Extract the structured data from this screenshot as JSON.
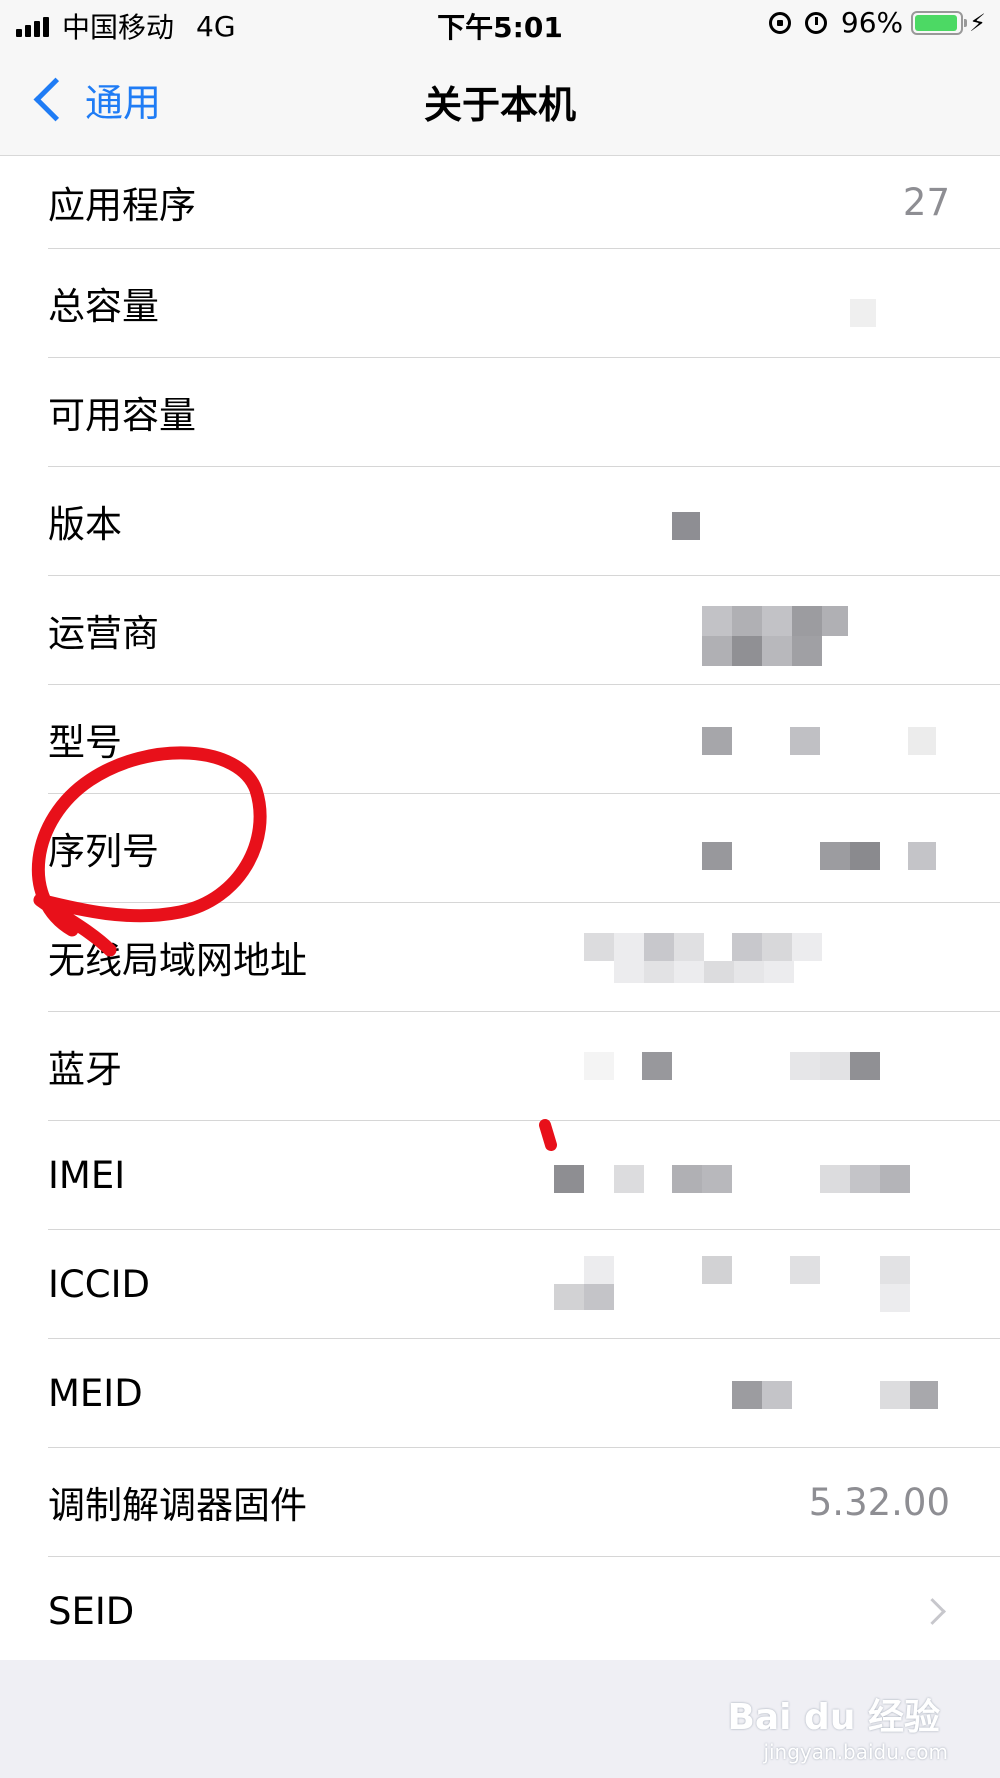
{
  "status_bar": {
    "carrier": "中国移动",
    "network": "4G",
    "time": "下午5:01",
    "battery_percent": "96%",
    "battery_level": 0.96,
    "battery_color": "#4cd964"
  },
  "nav": {
    "back_label": "通用",
    "title": "关于本机",
    "accent_color": "#1f7cf5"
  },
  "rows": [
    {
      "label": "应用程序",
      "value": "27"
    },
    {
      "label": "总容量",
      "value": ""
    },
    {
      "label": "可用容量",
      "value": ""
    },
    {
      "label": "版本",
      "value": ""
    },
    {
      "label": "运营商",
      "value": ""
    },
    {
      "label": "型号",
      "value": ""
    },
    {
      "label": "序列号",
      "value": ""
    },
    {
      "label": "无线局域网地址",
      "value": ""
    },
    {
      "label": "蓝牙",
      "value": ""
    },
    {
      "label": "IMEI",
      "value": ""
    },
    {
      "label": "ICCID",
      "value": ""
    },
    {
      "label": "MEID",
      "value": ""
    },
    {
      "label": "调制解调器固件",
      "value": "5.32.00"
    },
    {
      "label": "SEID",
      "value": ""
    }
  ],
  "watermark": {
    "logo": "Bai du 经验",
    "site": "jingyan.baidu.com"
  }
}
